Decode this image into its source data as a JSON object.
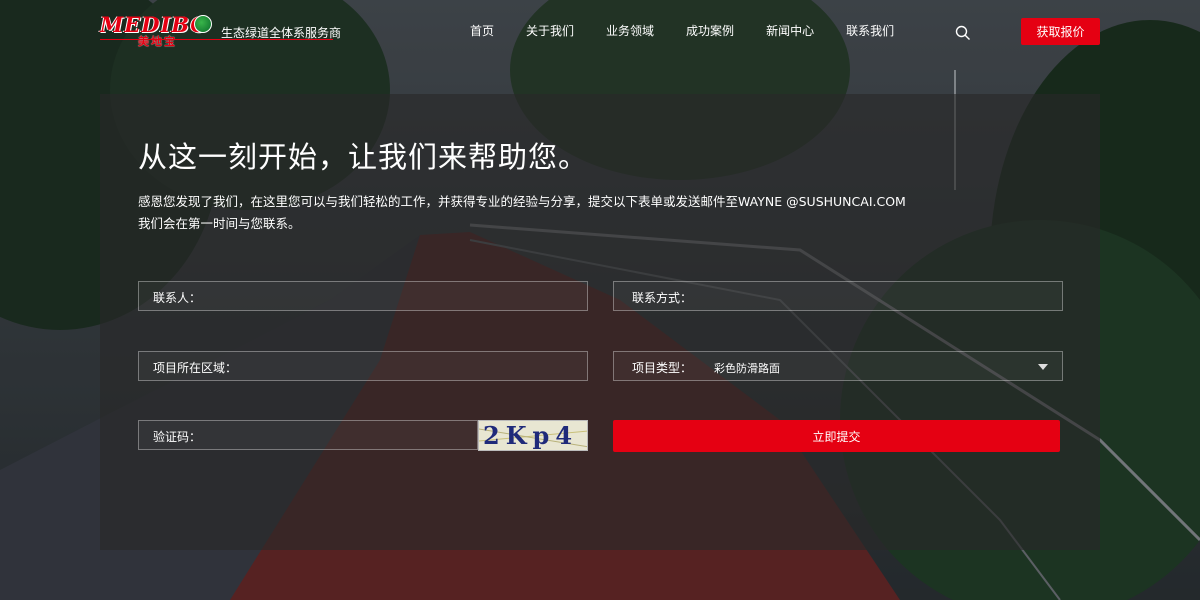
{
  "brand": {
    "logo_text": "MEDIBO",
    "logo_cn": "美地宝",
    "slogan": "生态绿道全体系服务商"
  },
  "nav": {
    "items": [
      {
        "label": "首页"
      },
      {
        "label": "关于我们"
      },
      {
        "label": "业务领域"
      },
      {
        "label": "成功案例"
      },
      {
        "label": "新闻中心"
      },
      {
        "label": "联系我们"
      }
    ],
    "quote_button": "获取报价"
  },
  "form": {
    "headline": "从这一刻开始，让我们来帮助您。",
    "intro_line1": "感恩您发现了我们，在这里您可以与我们轻松的工作，并获得专业的经验与分享，提交以下表单或发送邮件至WAYNE @SUSHUNCAI.COM",
    "intro_line2": "我们会在第一时间与您联系。",
    "contact_person_label": "联系人：",
    "contact_method_label": "联系方式：",
    "project_region_label": "项目所在区域：",
    "project_type_label": "项目类型：",
    "project_type_value": "彩色防滑路面",
    "captcha_label": "验证码：",
    "captcha_text": "2Kp4",
    "submit_label": "立即提交"
  },
  "colors": {
    "accent": "#e50012",
    "panel_overlay": "rgba(40,40,40,0.62)"
  }
}
